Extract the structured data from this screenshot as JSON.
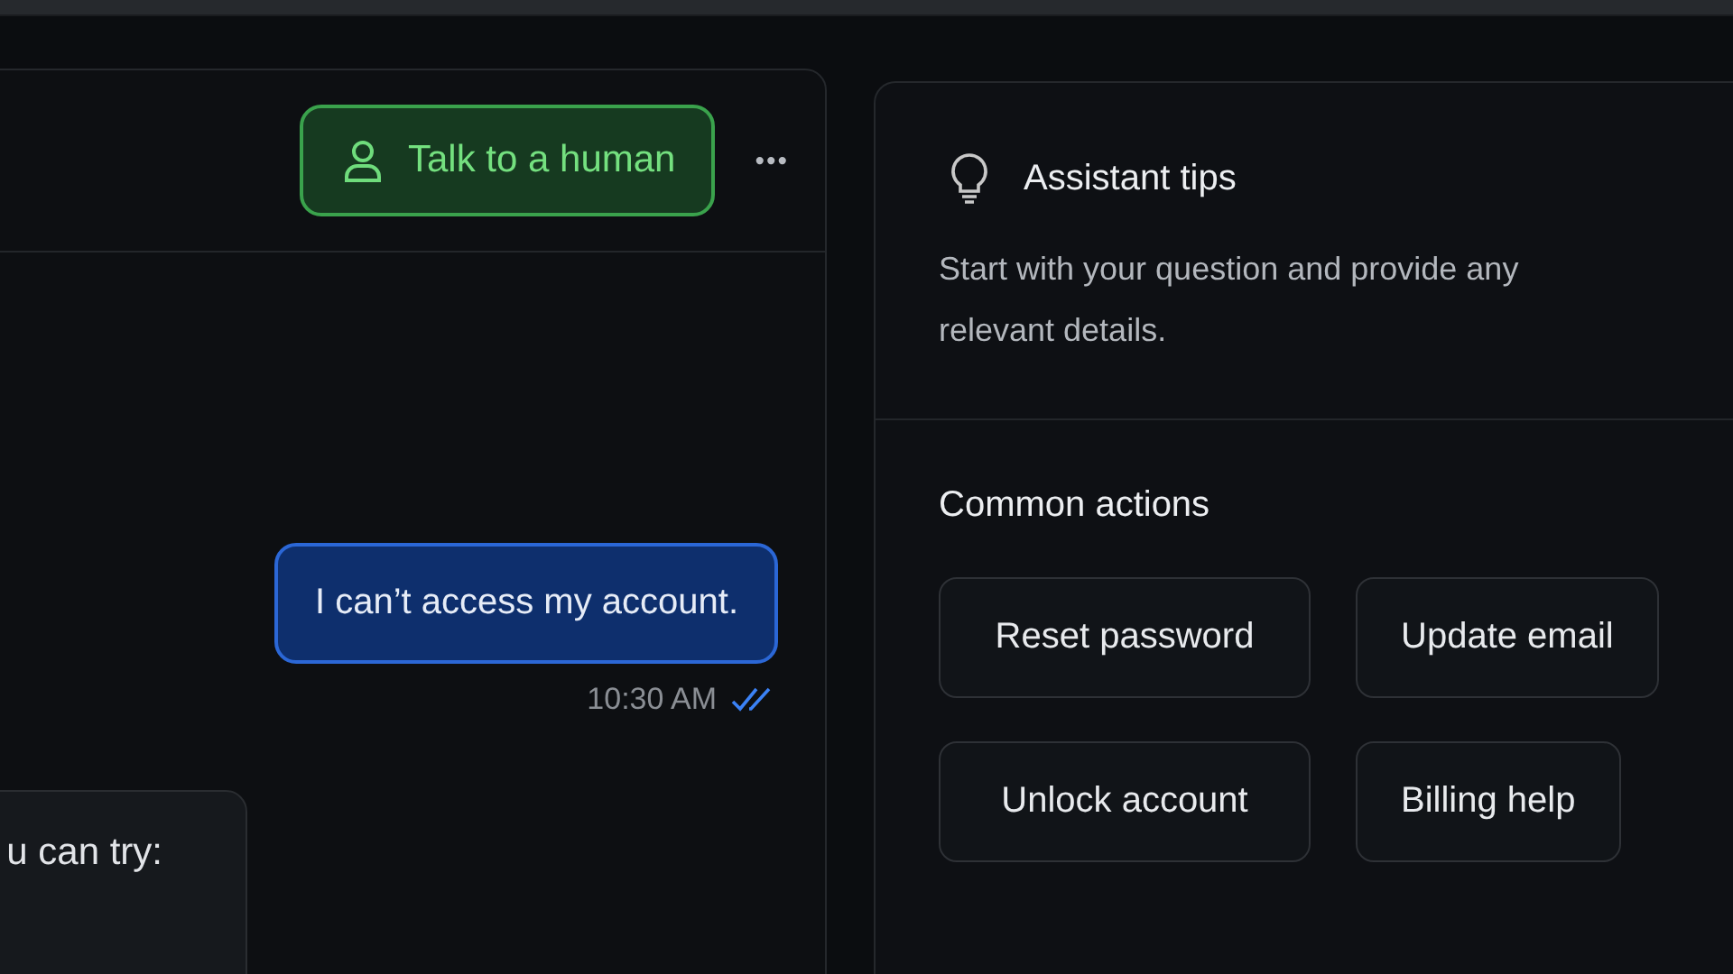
{
  "chat": {
    "talk_button": "Talk to a human",
    "more_button": "•••",
    "messages": [
      {
        "kind": "user",
        "text": "I can’t access my account.",
        "time": "10:30 AM",
        "read": true
      },
      {
        "kind": "agent",
        "text": "u can try:"
      }
    ]
  },
  "tips": {
    "title": "Assistant tips",
    "description": "Start with your question and provide any relevant details.",
    "actions_title": "Common actions",
    "actions": [
      "Reset password",
      "Update email",
      "Unlock account",
      "Billing help"
    ]
  }
}
